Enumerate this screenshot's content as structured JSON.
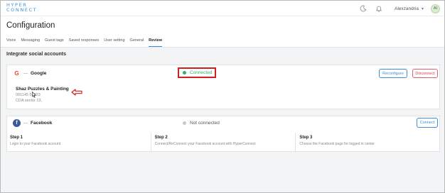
{
  "app": {
    "logo_line1": "HYPER",
    "logo_line2": "CONNECT",
    "user_name": "Alexzandria",
    "avatar_initials": "AI",
    "brand_color": "#3a8fd6"
  },
  "page": {
    "title": "Configuration",
    "tabs": [
      {
        "label": "Voice",
        "active": false
      },
      {
        "label": "Messaging",
        "active": false
      },
      {
        "label": "Guest tags",
        "active": false
      },
      {
        "label": "Saved responses",
        "active": false
      },
      {
        "label": "User setting",
        "active": false
      },
      {
        "label": "General",
        "active": false
      },
      {
        "label": "Review",
        "active": true
      }
    ],
    "section_title": "Integrate social accounts"
  },
  "google": {
    "name": "Google",
    "status": "Connected",
    "status_color": "#2fb36a",
    "reconfigure_label": "Reconfigure",
    "disconnect_label": "Disconnect",
    "business_name": "Shaz Puzzles & Painting",
    "business_phone": "091145 51323",
    "business_address": "CDA sector 13,"
  },
  "facebook": {
    "name": "Facebook",
    "status": "Not connected",
    "status_color": "#c8c8c8",
    "connect_label": "Connect",
    "steps": [
      {
        "title": "Step 1",
        "desc": "Login to your Facebook account"
      },
      {
        "title": "Step 2",
        "desc": "Connect/ReConnect your Facebook account with HyperConnect"
      },
      {
        "title": "Step 3",
        "desc": "Choose the Facebook page for logged in center"
      }
    ]
  },
  "icons": {
    "moon": "moon-icon",
    "bell": "bell-icon",
    "chevron": "chevron-down-icon",
    "google": "google-icon",
    "facebook": "facebook-icon",
    "arrow": "left-arrow-annotation-icon",
    "cursor": "mouse-cursor-icon"
  }
}
